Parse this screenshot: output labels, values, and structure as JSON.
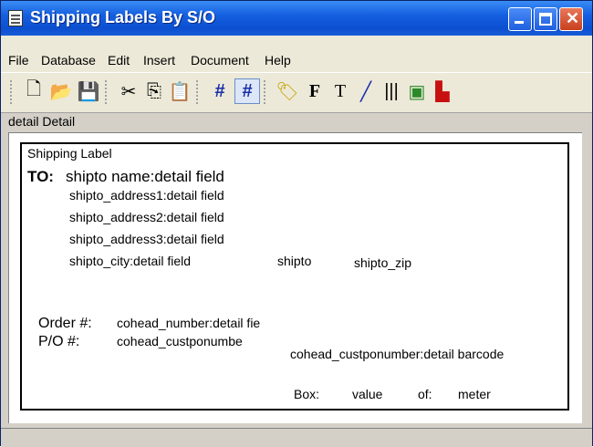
{
  "window": {
    "title": "Shipping Labels By S/O"
  },
  "menu": [
    "File",
    "Database",
    "Edit",
    "Insert",
    "Document",
    "Help"
  ],
  "toolbar_icons": [
    "new-icon",
    "open-icon",
    "save-icon",
    "cut-icon",
    "copy-icon",
    "paste-icon",
    "grid-icon",
    "snap-grid-icon",
    "label-icon",
    "field-icon",
    "text-icon",
    "line-icon",
    "barcode-icon",
    "image-icon",
    "graph-icon"
  ],
  "section": {
    "title": "detail Detail"
  },
  "label": {
    "heading": "Shipping Label",
    "to_label": "TO:",
    "shipto_name": "shipto  name:detail field",
    "addr1": "shipto_address1:detail field",
    "addr2": "shipto_address2:detail field",
    "addr3": "shipto_address3:detail field",
    "city": "shipto_city:detail field",
    "state": "shipto",
    "zip": "shipto_zip",
    "order_label": "Order #:",
    "order_field": "cohead_number:detail fie",
    "po_label": "P/O #:",
    "po_field": "cohead_custponumbe",
    "po_barcode": "cohead_custponumber:detail barcode",
    "box_label": "Box:",
    "box_value": "value",
    "of_label": "of:",
    "of_value": "meter"
  }
}
